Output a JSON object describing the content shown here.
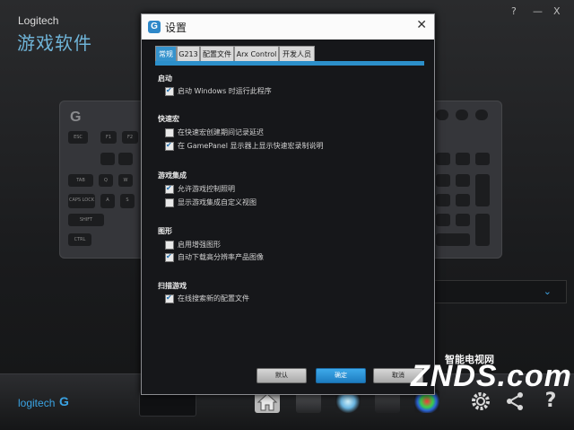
{
  "app": {
    "brand_small": "Logitech",
    "brand_title": "游戏软件",
    "footer_logo": "logitech",
    "window_controls": [
      "?",
      "—",
      "X"
    ]
  },
  "keyboard": {
    "keys": [
      "ESC",
      "F1",
      "F2",
      "TAB",
      "CAPS LOCK",
      "SHIFT",
      "CTRL",
      "A",
      "S",
      "Q",
      "W"
    ]
  },
  "dialog": {
    "title": "设置",
    "close": "✕",
    "tabs": [
      {
        "label": "常规",
        "active": true
      },
      {
        "label": "G213",
        "active": false
      },
      {
        "label": "配置文件",
        "active": false
      },
      {
        "label": "Arx Control",
        "active": false
      },
      {
        "label": "开发人员",
        "active": false
      }
    ],
    "sections": [
      {
        "title": "启动",
        "options": [
          {
            "label": "启动 Windows 时运行此程序",
            "checked": true
          }
        ]
      },
      {
        "title": "快速宏",
        "options": [
          {
            "label": "在快速宏创建期间记录延迟",
            "checked": false
          },
          {
            "label": "在 GamePanel 显示器上显示快速宏录制说明",
            "checked": true
          }
        ]
      },
      {
        "title": "游戏集成",
        "options": [
          {
            "label": "允许游戏控制照明",
            "checked": true
          },
          {
            "label": "显示游戏集成自定义视图",
            "checked": false
          }
        ]
      },
      {
        "title": "图形",
        "options": [
          {
            "label": "启用增强图形",
            "checked": false
          },
          {
            "label": "自动下载高分辨率产品图像",
            "checked": true
          }
        ]
      },
      {
        "title": "扫描游戏",
        "options": [
          {
            "label": "在线搜索新的配置文件",
            "checked": true
          }
        ]
      }
    ],
    "buttons": {
      "defaults": "默认",
      "ok": "确定",
      "cancel": "取消"
    }
  },
  "watermark": {
    "top": "智能电视网",
    "main": "ZNDS.com"
  },
  "colors": {
    "accent": "#2c8fca",
    "brand": "#3aa3e3",
    "title_text": "#6fb4d8"
  }
}
